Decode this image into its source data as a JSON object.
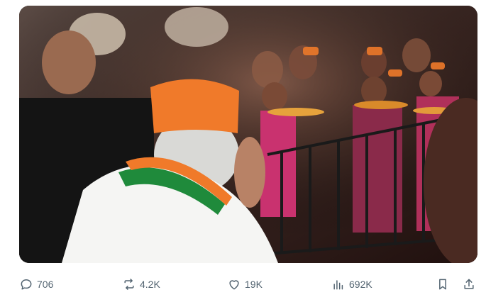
{
  "post": {
    "media": {
      "kind": "video",
      "icon": "video-frame"
    },
    "actions": {
      "replies": "706",
      "reposts": "4.2K",
      "likes": "19K",
      "views": "692K"
    },
    "icons": {
      "reply": "reply-icon",
      "repost": "repost-icon",
      "like": "like-icon",
      "views": "views-icon",
      "bookmark": "bookmark-icon",
      "share": "share-icon"
    },
    "colors": {
      "icon": "#536471",
      "saffron": "#f07a2a",
      "green": "#1f8a3b"
    }
  }
}
